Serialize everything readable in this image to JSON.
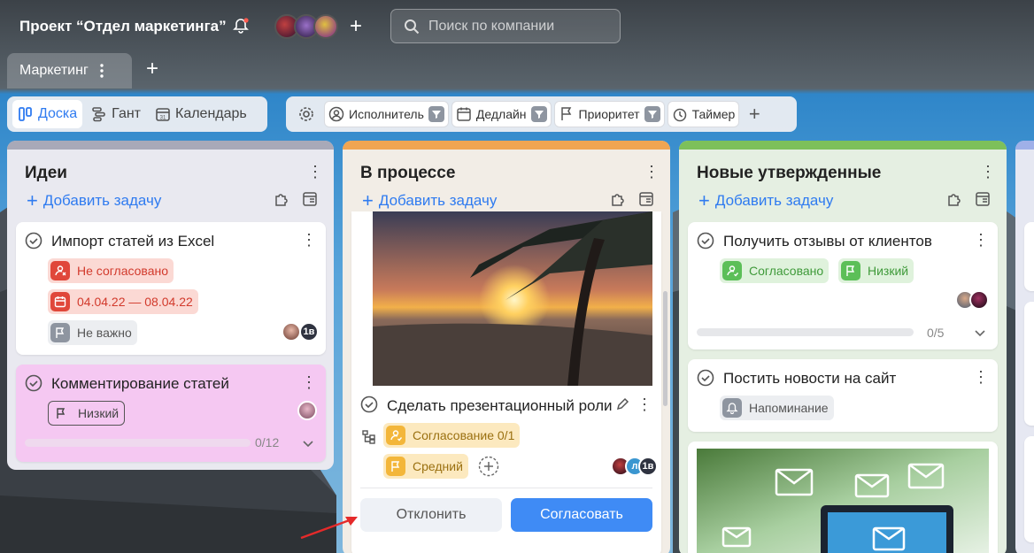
{
  "header": {
    "project_title": "Проект “Отдел маркетинга”",
    "search_placeholder": "Поиск по компании",
    "add_member_label": "+",
    "tab_label": "Маркетинг",
    "add_tab_label": "+"
  },
  "views": [
    {
      "label": "Доска",
      "icon": "board-icon",
      "active": true
    },
    {
      "label": "Гант",
      "icon": "gantt-icon",
      "active": false
    },
    {
      "label": "Календарь",
      "icon": "calendar-icon",
      "active": false
    }
  ],
  "filters": {
    "settings_icon": "gear-icon",
    "items": [
      {
        "label": "Исполнитель",
        "icon": "user-icon"
      },
      {
        "label": "Дедлайн",
        "icon": "calendar-icon"
      },
      {
        "label": "Приоритет",
        "icon": "flag-icon"
      }
    ],
    "timer_label": "Таймер",
    "add_label": "+"
  },
  "columns": [
    {
      "title": "Идеи",
      "accent": "#a8a9b8",
      "add_task": "Добавить задачу",
      "cards": [
        {
          "title": "Импорт статей из Excel",
          "tags": [
            {
              "label": "Не согласовано",
              "icon": "user-reject-icon",
              "color": "#e0473a"
            },
            {
              "label": "04.04.22 — 08.04.22",
              "icon": "calendar-icon",
              "color": "#e0473a"
            },
            {
              "label": "Не важно",
              "icon": "flag-icon",
              "color": "#8e95a0"
            }
          ],
          "assignee_initials": "1в"
        },
        {
          "title": "Комментирование статей",
          "tags": [
            {
              "label": "Низкий",
              "icon": "flag-icon",
              "color": "#555"
            }
          ],
          "progress_text": "0/12",
          "progress": 0
        }
      ]
    },
    {
      "title": "В процессе",
      "accent": "#f0a552",
      "add_task": "Добавить задачу",
      "cards": [
        {
          "title": "Сделать презентационный роли",
          "tags": [
            {
              "label": "Согласование 0/1",
              "icon": "user-check-icon",
              "color": "#f3b63a"
            },
            {
              "label": "Средний",
              "icon": "flag-icon",
              "color": "#f3b63a"
            }
          ],
          "assignee_initials": [
            "л",
            "1в"
          ],
          "reject_label": "Отклонить",
          "approve_label": "Согласовать"
        }
      ]
    },
    {
      "title": "Новые утвержденные",
      "accent": "#7dc05a",
      "add_task": "Добавить задачу",
      "cards": [
        {
          "title": "Получить отзывы от клиентов",
          "tags": [
            {
              "label": "Согласовано",
              "icon": "user-check-icon",
              "color": "#5cbf58"
            },
            {
              "label": "Низкий",
              "icon": "flag-icon",
              "color": "#5cbf58"
            }
          ],
          "progress_text": "0/5",
          "progress": 0
        },
        {
          "title": "Постить новости на сайт",
          "tags": [
            {
              "label": "Напоминание",
              "icon": "bell-icon",
              "color": "#8e95a0"
            }
          ]
        }
      ]
    }
  ]
}
